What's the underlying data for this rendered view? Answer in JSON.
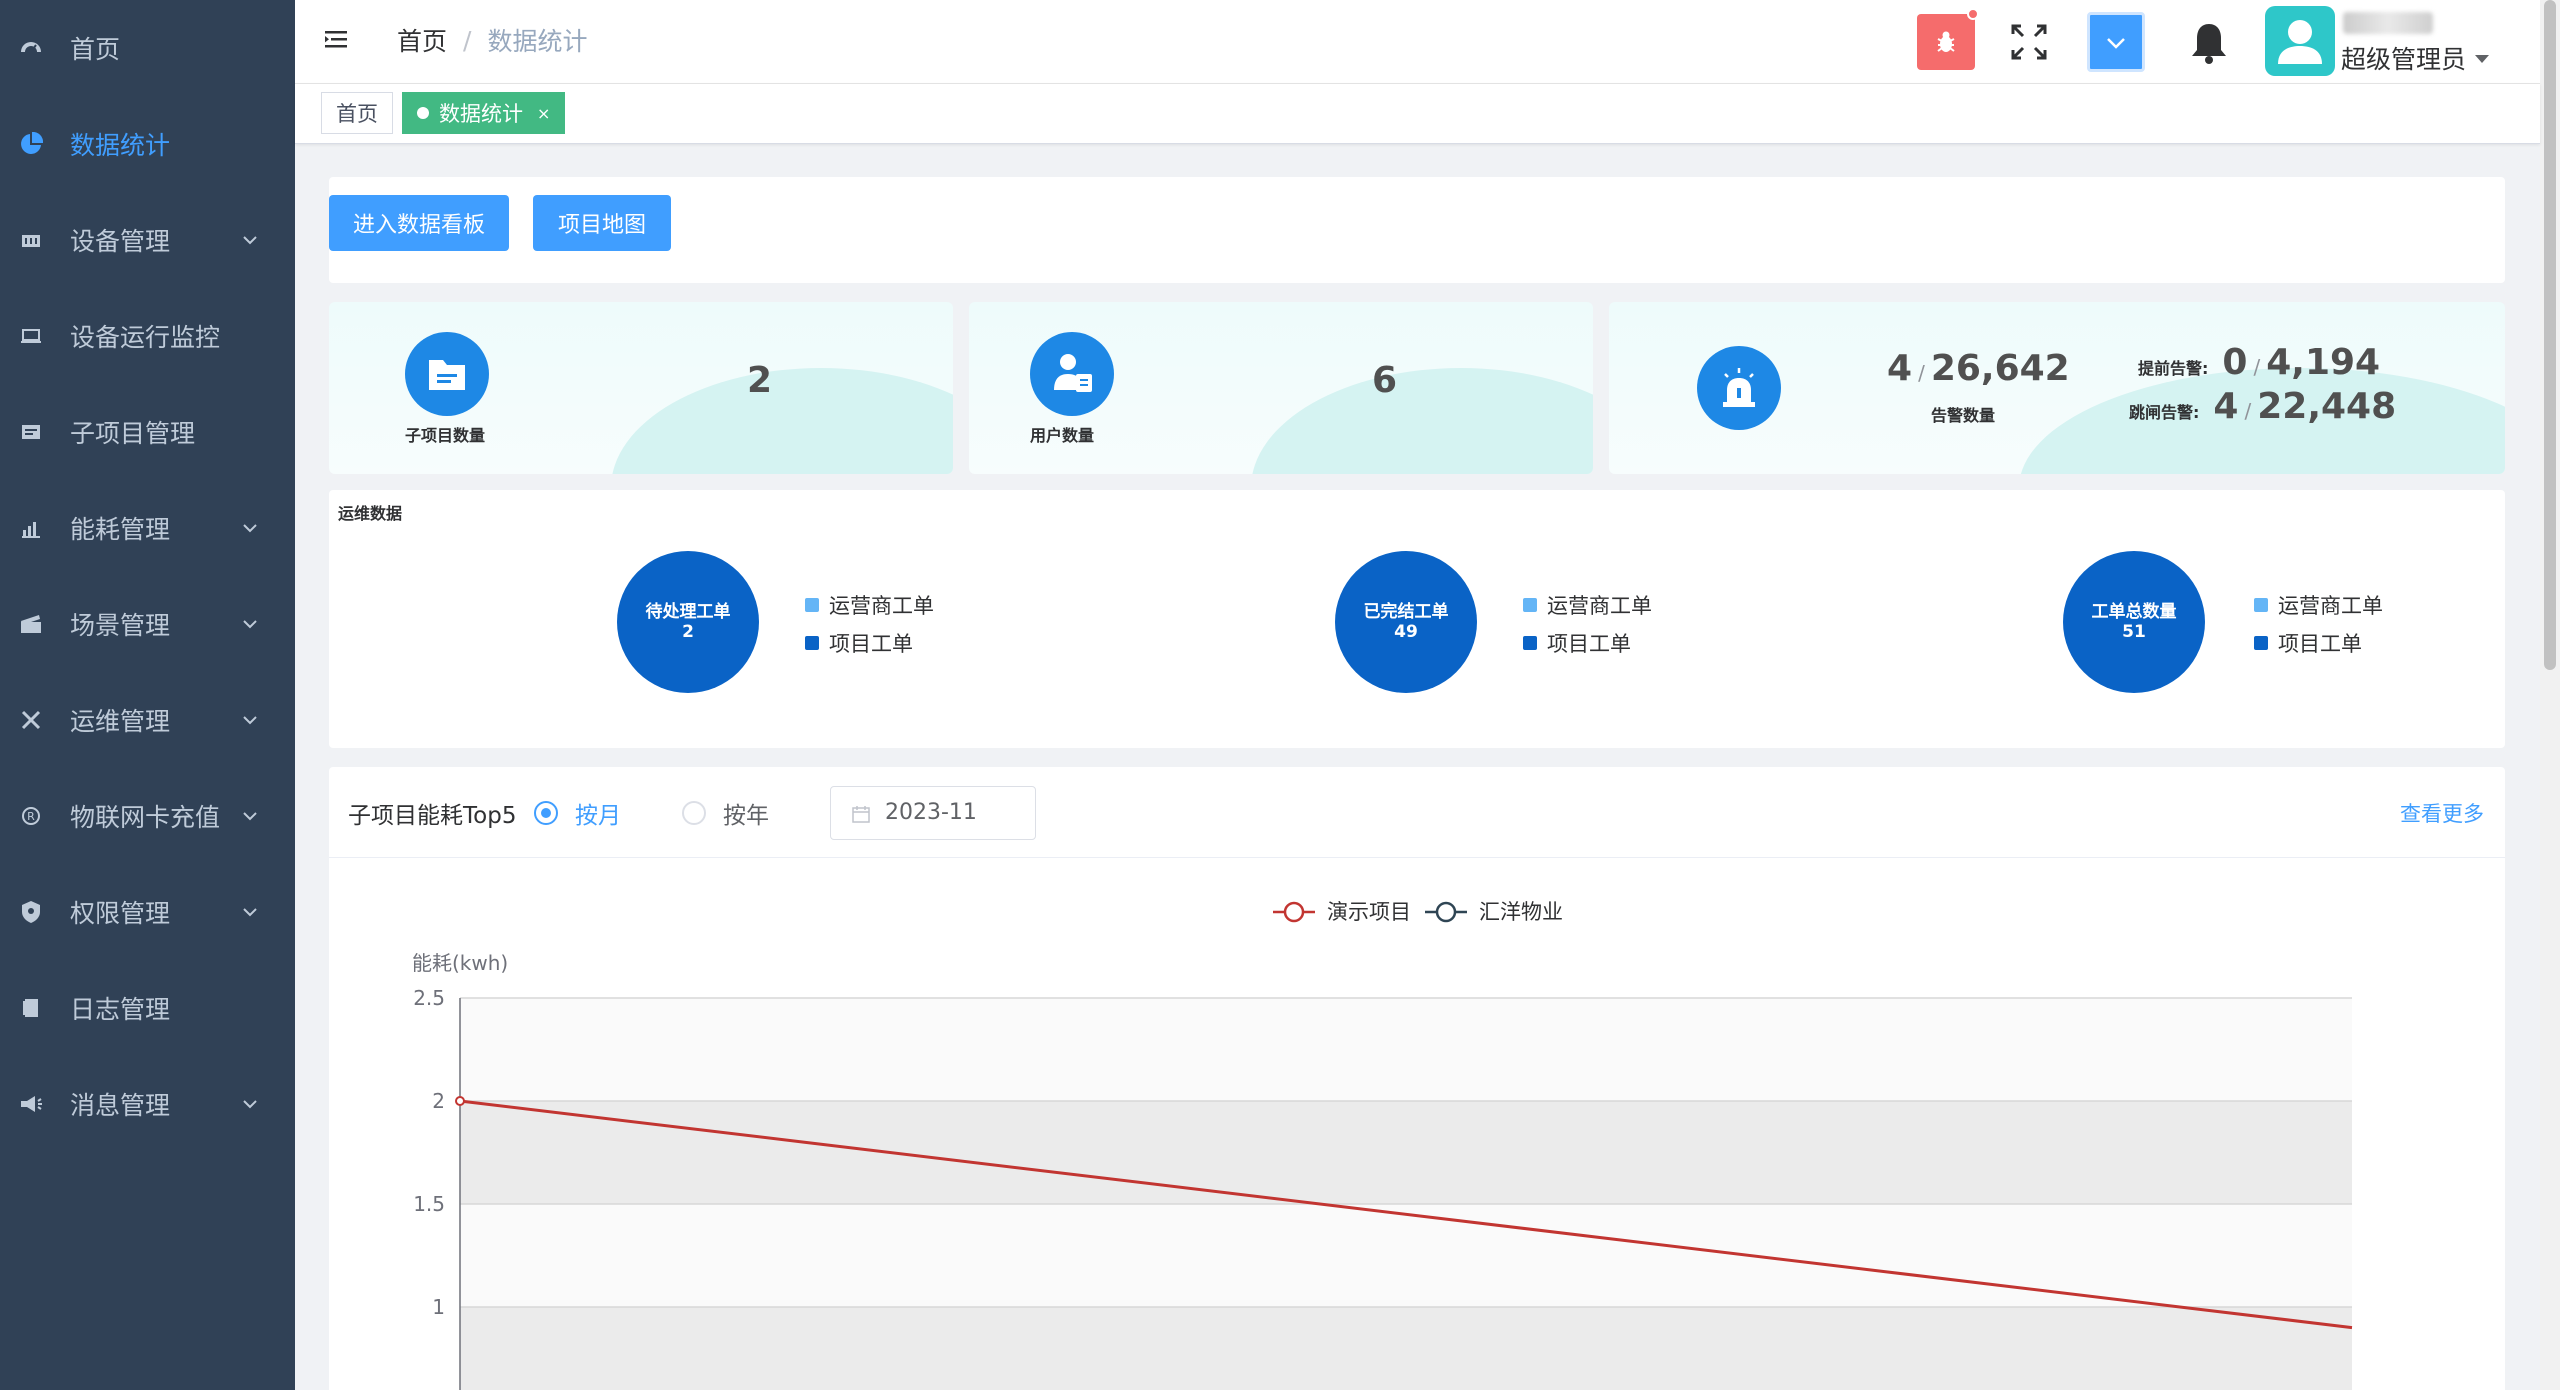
{
  "sidebar": {
    "items": [
      {
        "label": "首页",
        "icon": "dashboard-icon",
        "has_children": false,
        "active": false
      },
      {
        "label": "数据统计",
        "icon": "pie-chart-icon",
        "has_children": false,
        "active": true
      },
      {
        "label": "设备管理",
        "icon": "device-icon",
        "has_children": true,
        "active": false
      },
      {
        "label": "设备运行监控",
        "icon": "monitor-icon",
        "has_children": false,
        "active": false
      },
      {
        "label": "子项目管理",
        "icon": "subproject-icon",
        "has_children": false,
        "active": false
      },
      {
        "label": "能耗管理",
        "icon": "energy-chart-icon",
        "has_children": true,
        "active": false
      },
      {
        "label": "场景管理",
        "icon": "scene-icon",
        "has_children": true,
        "active": false
      },
      {
        "label": "运维管理",
        "icon": "tools-icon",
        "has_children": true,
        "active": false
      },
      {
        "label": "物联网卡充值",
        "icon": "registered-icon",
        "has_children": true,
        "active": false
      },
      {
        "label": "权限管理",
        "icon": "shield-icon",
        "has_children": true,
        "active": false
      },
      {
        "label": "日志管理",
        "icon": "log-icon",
        "has_children": false,
        "active": false
      },
      {
        "label": "消息管理",
        "icon": "megaphone-icon",
        "has_children": true,
        "active": false
      }
    ]
  },
  "header": {
    "breadcrumb": [
      "首页",
      "数据统计"
    ],
    "separator": "/",
    "user_role": "超级管理员"
  },
  "tags": [
    {
      "label": "首页",
      "active": false
    },
    {
      "label": "数据统计",
      "active": true,
      "close": "×"
    }
  ],
  "toolbar": {
    "dashboard_button": "进入数据看板",
    "map_button": "项目地图"
  },
  "stats": {
    "subproject": {
      "label": "子项目数量",
      "value": "2"
    },
    "users": {
      "label": "用户数量",
      "value": "6"
    },
    "alarms": {
      "current": "4",
      "slash": "/",
      "total": "26,642",
      "label": "告警数量",
      "early_label": "提前告警:",
      "early_current": "0",
      "early_total": "4,194",
      "trip_label": "跳闸告警:",
      "trip_current": "4",
      "trip_total": "22,448"
    }
  },
  "ops": {
    "title": "运维数据",
    "groups": [
      {
        "title": "待处理工单",
        "value": "2",
        "legend": [
          "运营商工单",
          "项目工单"
        ]
      },
      {
        "title": "已完结工单",
        "value": "49",
        "legend": [
          "运营商工单",
          "项目工单"
        ]
      },
      {
        "title": "工单总数量",
        "value": "51",
        "legend": [
          "运营商工单",
          "项目工单"
        ]
      }
    ],
    "legend_colors": [
      "#64b5f6",
      "#0a63c6"
    ]
  },
  "energy": {
    "title": "子项目能耗Top5",
    "radio_month": "按月",
    "radio_year": "按年",
    "selected": "month",
    "date_value": "2023-11",
    "more_link": "查看更多"
  },
  "chart_data": {
    "type": "line",
    "ylabel": "能耗(kwh)",
    "ylim": [
      0,
      2.5
    ],
    "yticks": [
      "2.5",
      "2",
      "1.5",
      "1"
    ],
    "series": [
      {
        "name": "演示项目",
        "color": "#c23531",
        "values": [
          2,
          0.9
        ]
      },
      {
        "name": "汇洋物业",
        "color": "#2f4554",
        "values": []
      }
    ],
    "legend_position": "top-center"
  },
  "colors": {
    "sidebar_bg": "#304156",
    "sidebar_text": "#bfcbd9",
    "accent": "#409eff",
    "tag_active": "#42b983",
    "danger": "#f56c6c"
  }
}
